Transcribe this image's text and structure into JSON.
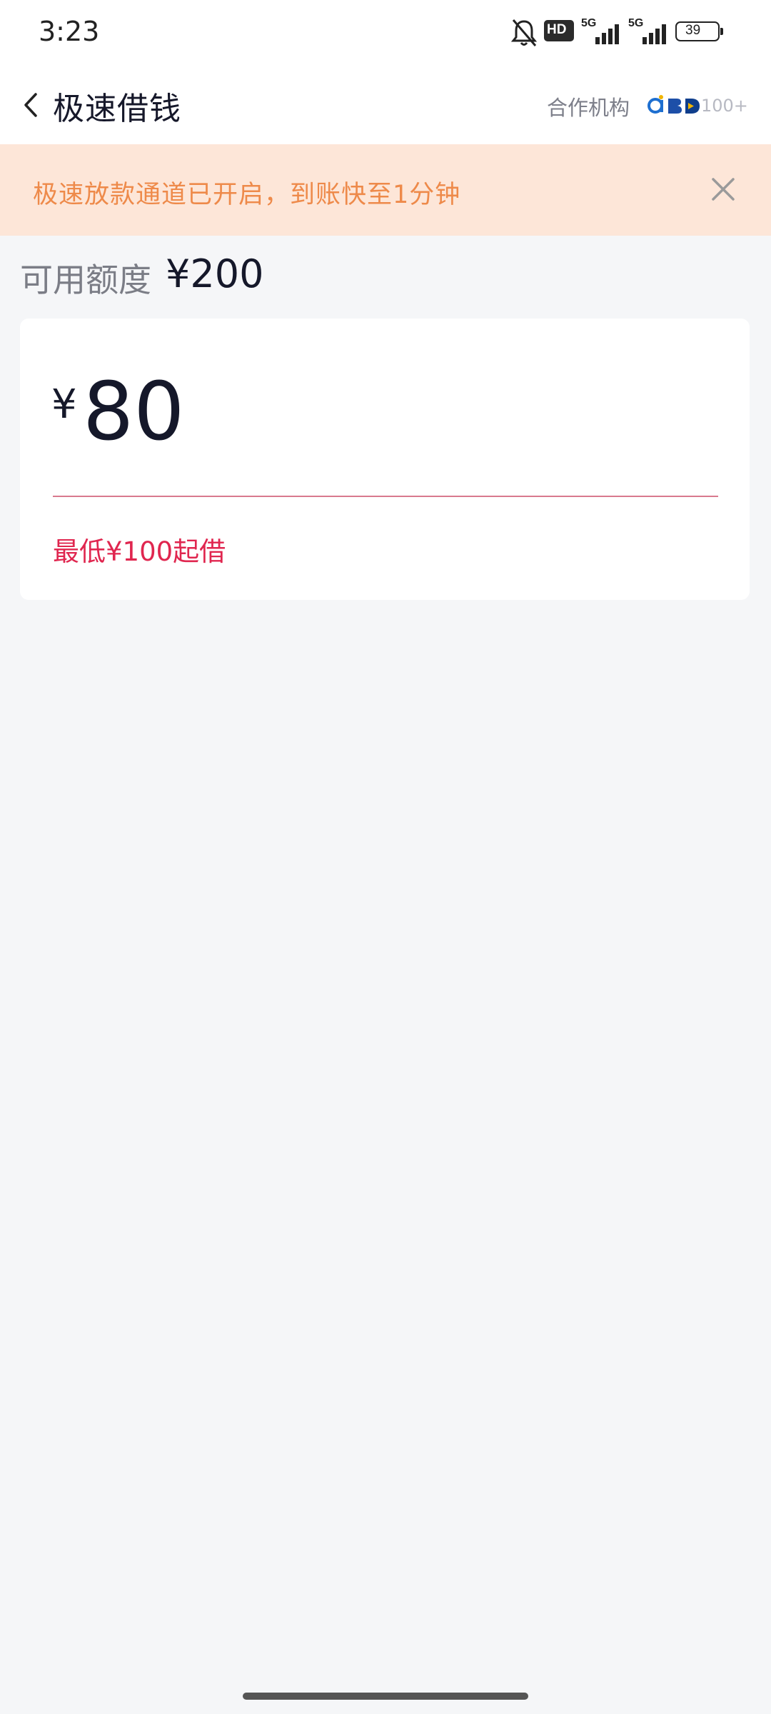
{
  "status_bar": {
    "time": "3:23",
    "icons": [
      "bell-muted-icon",
      "hd-icon",
      "signal-5g-icon",
      "signal-5g-icon",
      "battery-icon"
    ],
    "network_1": "5G",
    "network_2": "5G",
    "hd_label": "HD",
    "battery_level": "39"
  },
  "nav": {
    "title": "极速借钱",
    "back_icon": "chevron-left-icon",
    "partner_label": "合作机构",
    "partner_count": "100+"
  },
  "banner": {
    "text": "极速放款通道已开启，到账快至1分钟",
    "close_icon": "close-icon",
    "background": "#fde6d8",
    "text_color": "#ee8a4a"
  },
  "credit": {
    "label": "可用额度",
    "value": "¥200"
  },
  "amount": {
    "currency": "¥",
    "value": "80",
    "hint": "最低¥100起借",
    "hint_color": "#e0264f"
  }
}
